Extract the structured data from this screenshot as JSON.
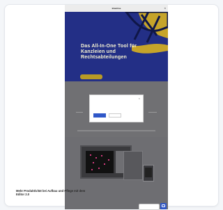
{
  "topbar": {
    "brand": "Brainline",
    "close_icon": "close-icon"
  },
  "hero": {
    "title": "Das All-In-One Tool für Kanzleien und Rechtsabteilungen",
    "cta_label": "",
    "colors": {
      "background": "#232f86",
      "accent": "#b99a25",
      "title": "#f7f4d3"
    }
  },
  "cookie_modal": {
    "title": "",
    "text": "",
    "accept_label": "",
    "deny_label": "",
    "settings_label": "",
    "footer": ""
  },
  "bottom": {
    "heading": "Mehr Produktivität bei Aufbau und Pflege mit dem Editor 2.0"
  },
  "floating": {
    "cookie_pill": "",
    "chat_icon": "chat-icon",
    "chat_color": "#2f57c8"
  }
}
